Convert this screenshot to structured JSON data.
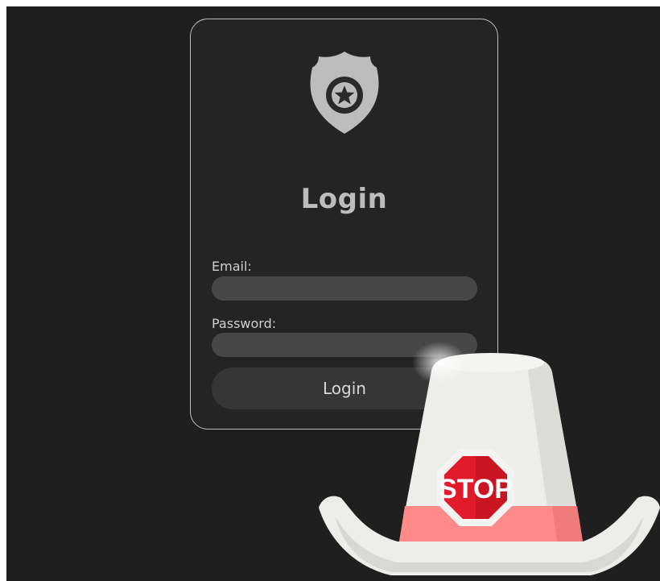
{
  "login_card": {
    "title": "Login",
    "email_label": "Email:",
    "email_value": "",
    "password_label": "Password:",
    "password_value": "",
    "button_label": "Login"
  },
  "icons": {
    "badge": "police-badge-icon",
    "cone": "stop-cone-illustration"
  },
  "cone_sign": {
    "text": "STOP"
  },
  "colors": {
    "background": "#1f1f1f",
    "card": "#242424",
    "badge": "#bdbdbd",
    "stop_red": "#e21b2a",
    "cone_white": "#eeeeea",
    "cone_stripe": "#ff8a8a"
  }
}
